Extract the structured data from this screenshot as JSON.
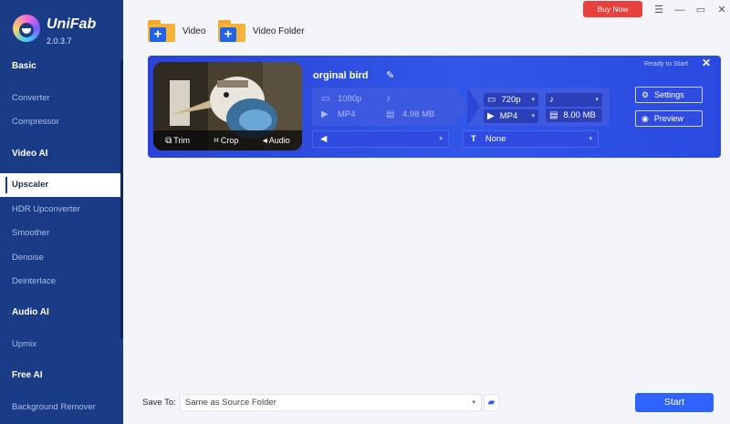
{
  "app": {
    "name": "UniFab",
    "version": "2.0.3.7"
  },
  "titlebar": {
    "buy_now": "Buy Now"
  },
  "sidebar": {
    "sections": [
      {
        "heading": "Basic",
        "items": [
          "Converter",
          "Compressor"
        ]
      },
      {
        "heading": "Video AI",
        "items": [
          "Upscaler",
          "HDR Upconverter",
          "Smoother",
          "Denoise",
          "Deinterlace"
        ]
      },
      {
        "heading": "Audio AI",
        "items": [
          "Upmix"
        ]
      },
      {
        "heading": "Free AI",
        "items": [
          "Background Remover"
        ]
      }
    ],
    "active_item": "Upscaler"
  },
  "toolbar": {
    "add_video": "Video",
    "add_folder": "Video Folder"
  },
  "task": {
    "title": "orginal bird",
    "status": "Ready to Start",
    "thumb_actions": {
      "trim": "Trim",
      "crop": "Crop",
      "audio": "Audio"
    },
    "source": {
      "resolution": "1080p",
      "format": "MP4",
      "size": "4.98 MB"
    },
    "output": {
      "resolution": "720p",
      "format": "MP4",
      "size": "8.00 MB"
    },
    "audio_select": "",
    "subtitle_select": "None",
    "settings": "Settings",
    "preview": "Preview"
  },
  "footer": {
    "save_to_label": "Save To:",
    "save_to_value": "Same as Source Folder",
    "start": "Start"
  },
  "colors": {
    "sidebar": "#1a3b86",
    "card": "#3157e8",
    "accent": "#2e63ff",
    "buy": "#e8403d"
  }
}
